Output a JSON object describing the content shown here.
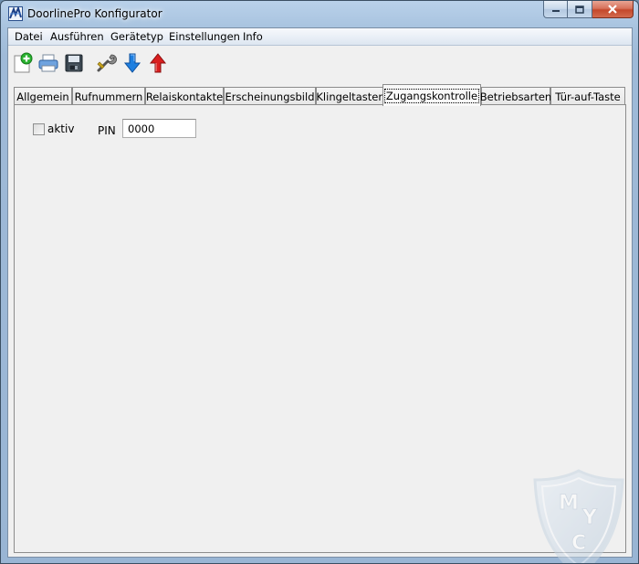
{
  "window": {
    "title": "DoorlinePro Konfigurator",
    "icons": {
      "app": "doorline-app-icon",
      "minimize": "minimize-icon",
      "maximize": "maximize-icon",
      "close": "close-icon"
    }
  },
  "menu": {
    "items": [
      "Datei",
      "Ausführen",
      "Gerätetyp",
      "Einstellungen",
      "Info"
    ]
  },
  "toolbar": {
    "buttons": [
      {
        "icon": "new-file-icon"
      },
      {
        "icon": "print-icon"
      },
      {
        "icon": "save-icon"
      },
      {
        "icon": "settings-wrench-icon"
      },
      {
        "icon": "download-arrow-icon"
      },
      {
        "icon": "upload-arrow-icon"
      }
    ]
  },
  "tabs": {
    "items": [
      "Allgemein",
      "Rufnummern",
      "Relaiskontakte",
      "Erscheinungsbild",
      "Klingeltasten",
      "Zugangskontrolle",
      "Betriebsarten",
      "Tür-auf-Taste"
    ],
    "active": "Zugangskontrolle"
  },
  "panel": {
    "aktiv_label": "aktiv",
    "aktiv_checked": false,
    "pin_label": "PIN",
    "pin_value": "0000"
  },
  "watermark": {
    "icon": "myc-shield-watermark",
    "text_top": "M",
    "text_mid": "Y",
    "text_bottom": "C"
  },
  "colors": {
    "titlebar": "#a8c3df",
    "close_button": "#c4482b",
    "client_bg": "#f0f0f0",
    "arrow_down": "#1e7fe0",
    "arrow_up": "#d91f1f"
  }
}
